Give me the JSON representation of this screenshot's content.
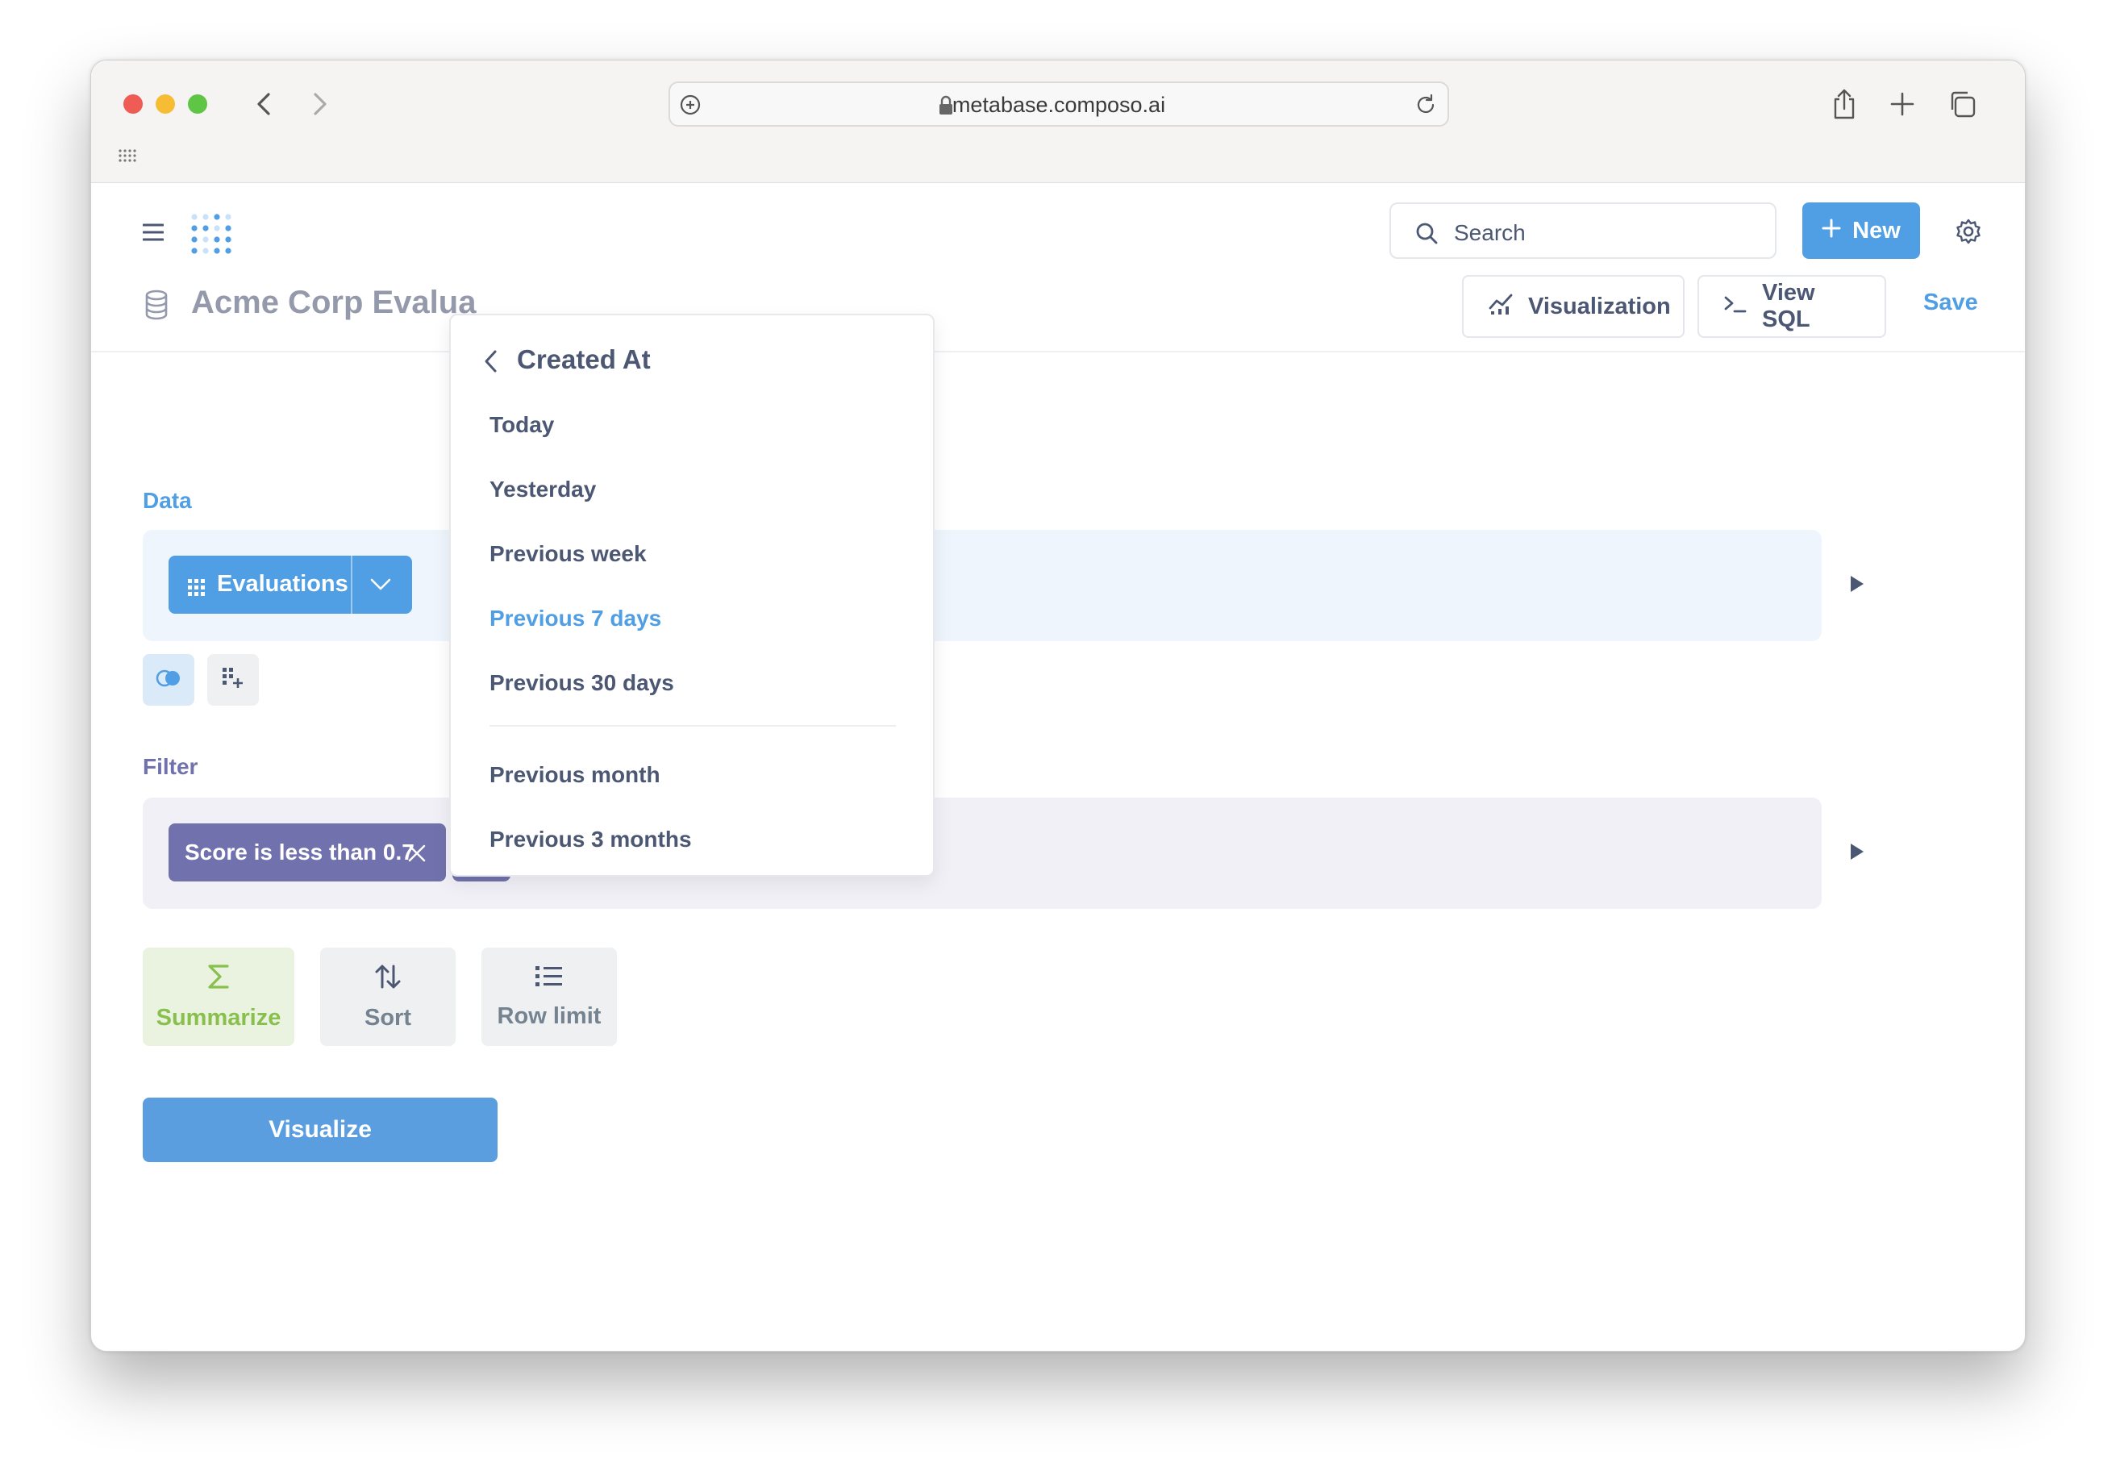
{
  "browser": {
    "url": "metabase.composo.ai"
  },
  "header": {
    "search_label": "Search",
    "new_button": "New"
  },
  "question": {
    "title": "Acme Corp Evalua",
    "visualization_button": "Visualization",
    "view_sql_button": "View SQL",
    "save_link": "Save"
  },
  "notebook": {
    "data_label": "Data",
    "data_source": "Evaluations",
    "filter_label": "Filter",
    "filter_pill": "Score is less than 0.7",
    "steps": {
      "summarize": "Summarize",
      "sort": "Sort",
      "row_limit": "Row limit"
    },
    "visualize_button": "Visualize"
  },
  "date_popover": {
    "title": "Created At",
    "items": [
      {
        "label": "Today"
      },
      {
        "label": "Yesterday"
      },
      {
        "label": "Previous week"
      },
      {
        "label": "Previous 7 days",
        "active": true
      },
      {
        "label": "Previous 30 days"
      },
      {
        "label": "Previous month"
      },
      {
        "label": "Previous 3 months"
      }
    ]
  },
  "colors": {
    "brand": "#509ee3",
    "filter": "#7172ad",
    "summarize": "#88bf4d",
    "text_dark": "#4c5773"
  },
  "icons": [
    "back-chevron-icon",
    "forward-chevron-icon",
    "lock-icon",
    "reload-icon",
    "share-icon",
    "new-tab-icon",
    "tabs-icon",
    "hamburger-icon",
    "metabase-logo",
    "search-icon",
    "plus-icon",
    "gear-icon",
    "database-icon",
    "line-chart-icon",
    "terminal-icon",
    "table-grid-icon",
    "chevron-down-icon",
    "join-icon",
    "custom-column-icon",
    "close-icon",
    "sigma-icon",
    "sort-arrows-icon",
    "list-icon",
    "play-icon"
  ]
}
